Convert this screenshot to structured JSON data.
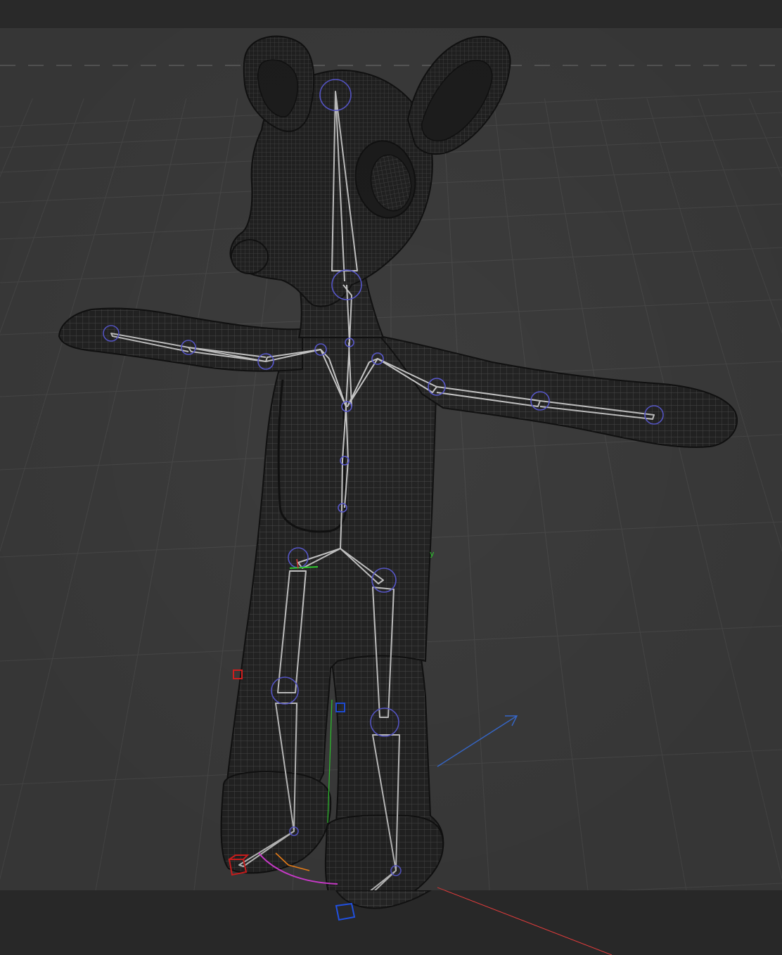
{
  "viewport": {
    "axis_label_y": "y",
    "colors": {
      "background": "#3d3d3d",
      "grid": "#4a4a4a",
      "horizon": "#6b6b6b",
      "mesh_fill": "#262626",
      "mesh_wire": "#505050",
      "bone": "#c8c8c8",
      "joint": "#5a5acd",
      "axis_x": "#e03c3c",
      "axis_y": "#2fd12f",
      "axis_z": "#3a6fd8",
      "ik_arc": "#e040e0",
      "ik_arc2": "#ff8a1a"
    },
    "icons": [
      "joint-handle-icon",
      "ik-handle-icon",
      "transform-gizmo-icon"
    ]
  }
}
